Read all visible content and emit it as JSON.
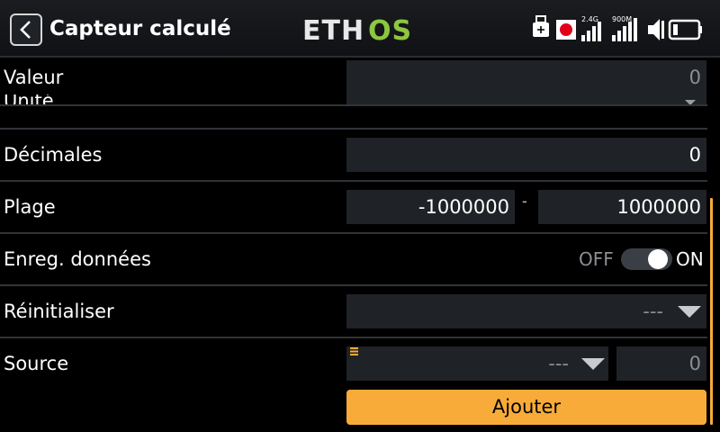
{
  "header": {
    "title": "Capteur calculé",
    "logo_text": "ETHOS",
    "logo_colors": {
      "eth": "#e8e8e8",
      "os": "#8dc63f"
    },
    "status": {
      "band_24": "2.4G",
      "band_900": "900M"
    }
  },
  "rows": {
    "valeur": {
      "label": "Valeur",
      "value": "0"
    },
    "unite": {
      "label": "Unité"
    },
    "decimales": {
      "label": "Décimales",
      "value": "0"
    },
    "plage": {
      "label": "Plage",
      "min": "-1000000",
      "sep": "-",
      "max": "1000000"
    },
    "enreg": {
      "label": "Enreg. données",
      "off": "OFF",
      "on": "ON",
      "state": true
    },
    "reinit": {
      "label": "Réinitialiser",
      "value": "---"
    },
    "source": {
      "label": "Source",
      "value": "---",
      "number": "0"
    }
  },
  "add_button": "Ajouter",
  "colors": {
    "accent": "#f8ab38",
    "field_bg": "#1f2227",
    "background": "#000000"
  }
}
